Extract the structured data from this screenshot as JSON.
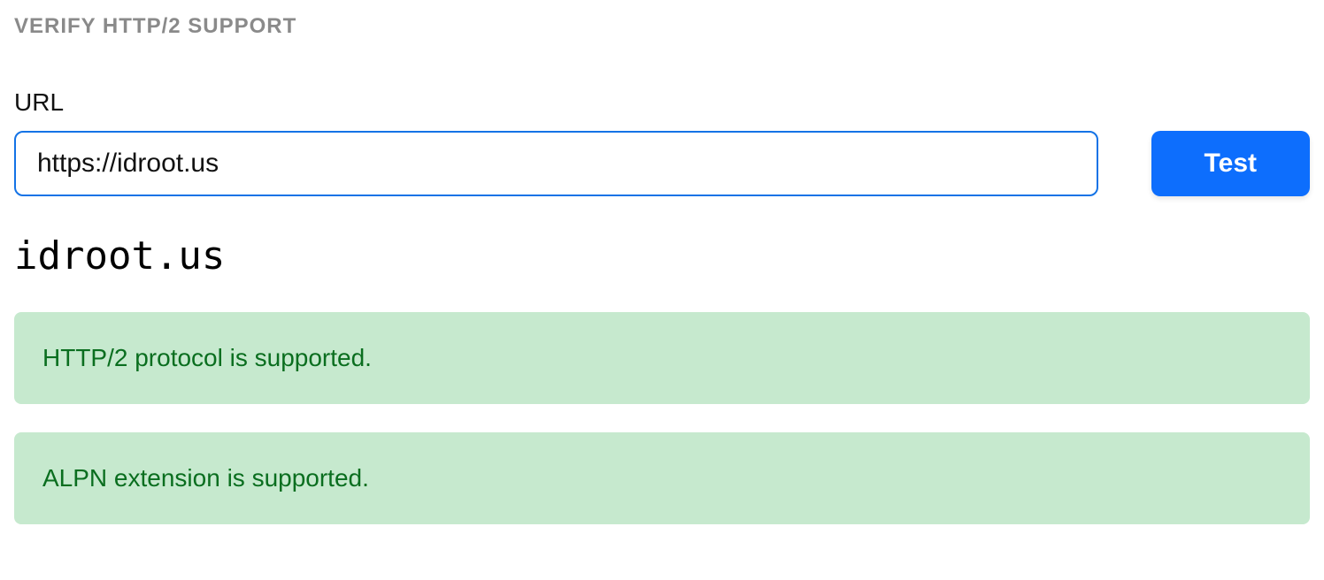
{
  "header": {
    "title": "VERIFY HTTP/2 SUPPORT"
  },
  "form": {
    "url_label": "URL",
    "url_value": "https://idroot.us",
    "test_button_label": "Test"
  },
  "result": {
    "domain": "idroot.us",
    "messages": [
      "HTTP/2 protocol is supported.",
      "ALPN extension is supported."
    ]
  }
}
